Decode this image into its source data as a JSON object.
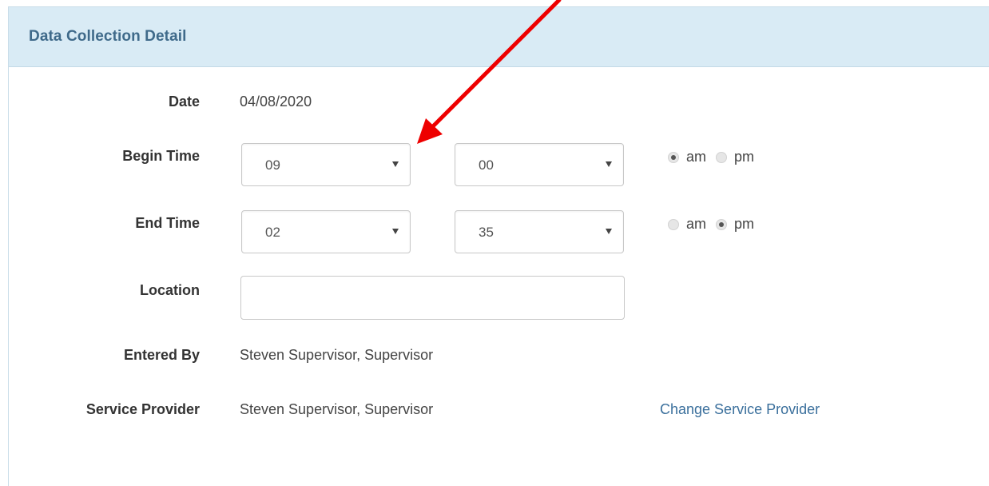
{
  "panel": {
    "title": "Data Collection Detail"
  },
  "form": {
    "date": {
      "label": "Date",
      "value": "04/08/2020"
    },
    "begin_time": {
      "label": "Begin Time",
      "hour": "09",
      "minute": "00",
      "am_label": "am",
      "pm_label": "pm",
      "selected": "am"
    },
    "end_time": {
      "label": "End Time",
      "hour": "02",
      "minute": "35",
      "am_label": "am",
      "pm_label": "pm",
      "selected": "pm"
    },
    "location": {
      "label": "Location",
      "value": ""
    },
    "entered_by": {
      "label": "Entered By",
      "value": "Steven Supervisor, Supervisor"
    },
    "service_provider": {
      "label": "Service Provider",
      "value": "Steven Supervisor, Supervisor",
      "change_link": "Change Service Provider"
    }
  },
  "colors": {
    "header_bg": "#d9ebf5",
    "title": "#3f6a8a",
    "link": "#3a6f9c",
    "annotation_arrow": "#ee0000"
  }
}
